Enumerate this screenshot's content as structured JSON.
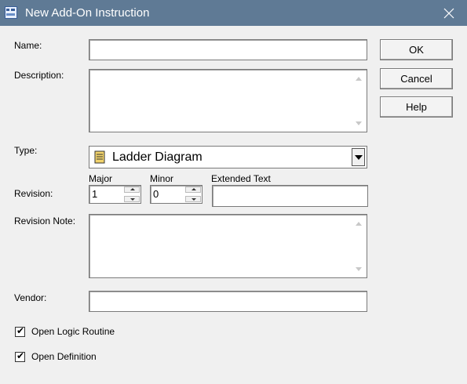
{
  "window": {
    "title": "New Add-On Instruction",
    "close_glyph": "✕"
  },
  "form": {
    "name_label": "Name:",
    "name_value": "",
    "description_label": "Description:",
    "description_value": "",
    "type_label": "Type:",
    "type_value": "Ladder Diagram",
    "revision_label": "Revision:",
    "major_label": "Major",
    "major_value": "1",
    "minor_label": "Minor",
    "minor_value": "0",
    "extended_text_label": "Extended Text",
    "extended_text_value": "",
    "revision_note_label": "Revision Note:",
    "revision_note_value": "",
    "vendor_label": "Vendor:",
    "vendor_value": "",
    "open_logic_label": "Open Logic Routine",
    "open_logic_checked": true,
    "open_definition_label": "Open Definition",
    "open_definition_checked": true,
    "check_glyph": "✔"
  },
  "buttons": {
    "ok": "OK",
    "cancel": "Cancel",
    "help": "Help"
  }
}
